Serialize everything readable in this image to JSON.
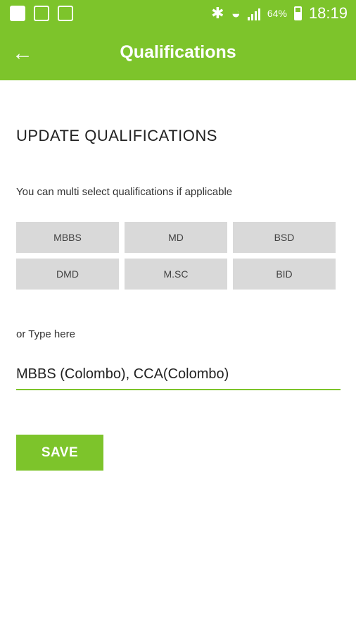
{
  "status_bar": {
    "battery": "64%",
    "time": "18:19"
  },
  "app_bar": {
    "title": "Qualifications"
  },
  "content": {
    "heading": "UPDATE QUALIFICATIONS",
    "hint": "You can multi select qualifications if applicable",
    "options": [
      "MBBS",
      "MD",
      "BSD",
      "DMD",
      "M.SC",
      "BID"
    ],
    "or_label": "or Type here",
    "input_value": "MBBS (Colombo), CCA(Colombo)",
    "save_label": "SAVE"
  },
  "colors": {
    "accent": "#7dc42b",
    "chip_bg": "#d9d9d9"
  }
}
